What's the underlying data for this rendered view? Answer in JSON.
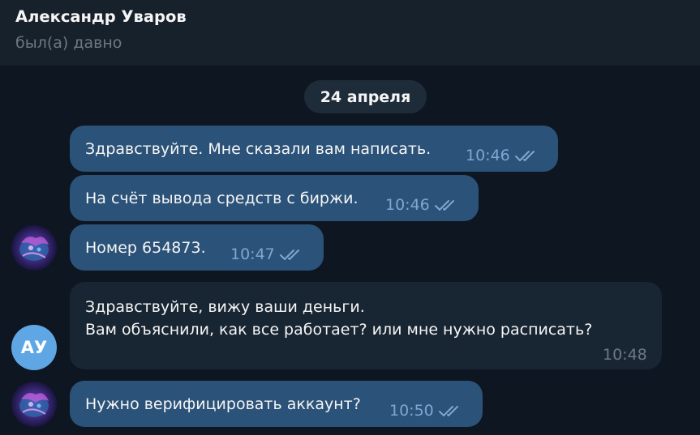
{
  "header": {
    "title": "Александр Уваров",
    "status": "был(а) давно"
  },
  "date_separator": "24 апреля",
  "messages": [
    {
      "direction": "out",
      "text": "Здравствуйте. Мне сказали вам написать.",
      "time": "10:46",
      "read": true
    },
    {
      "direction": "out",
      "text": "На счёт вывода средств с биржи.",
      "time": "10:46",
      "read": true
    },
    {
      "direction": "out",
      "text": "Номер 654873.",
      "time": "10:47",
      "read": true
    },
    {
      "direction": "in",
      "line1": "Здравствуйте, вижу ваши деньги.",
      "line2": "Вам объяснили, как все работает? или мне нужно расписать?",
      "time": "10:48"
    },
    {
      "direction": "out",
      "text": "Нужно верифицировать аккаунт?",
      "time": "10:50",
      "read": true
    }
  ],
  "avatars": {
    "contact_initials": "АУ",
    "contact_color": "#5fa7e4"
  },
  "colors": {
    "outgoing_bubble": "#2b5278",
    "incoming_bubble": "#182533",
    "background": "#0e1621",
    "header": "#17212b"
  }
}
